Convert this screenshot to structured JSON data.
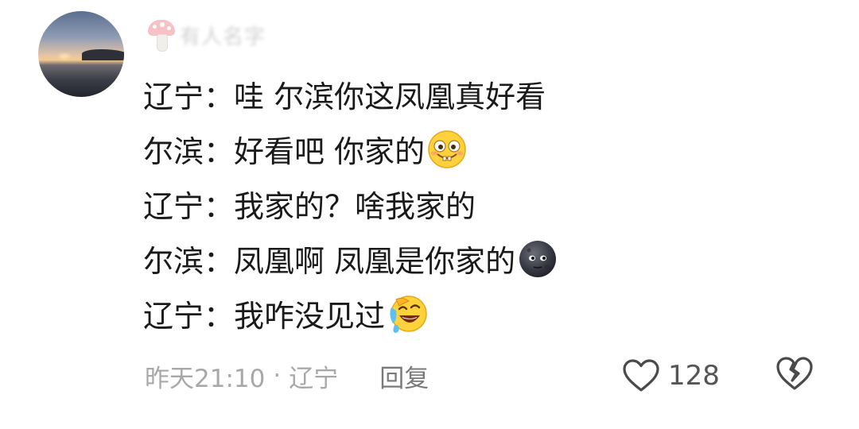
{
  "comment": {
    "username": "有人名字",
    "avatar": "sunset-photo",
    "badge_icon": "mushroom-icon",
    "lines": [
      {
        "speaker": "辽宁：",
        "text": "哇 尔滨你这凤凰真好看",
        "emoji": ""
      },
      {
        "speaker": "尔滨：",
        "text": "好看吧 你家的",
        "emoji": "silly-face-emoji"
      },
      {
        "speaker": "辽宁：",
        "text": "我家的？啥我家的",
        "emoji": ""
      },
      {
        "speaker": "尔滨：",
        "text": "凤凰啊 凤凰是你家的",
        "emoji": "dark-moon-face-emoji"
      },
      {
        "speaker": "辽宁：",
        "text": "我咋没见过",
        "emoji": "laugh-cry-emoji"
      }
    ],
    "footer": {
      "time": "昨天21:10",
      "separator": "·",
      "location": "辽宁",
      "reply_label": "回复",
      "like_count": "128"
    }
  }
}
